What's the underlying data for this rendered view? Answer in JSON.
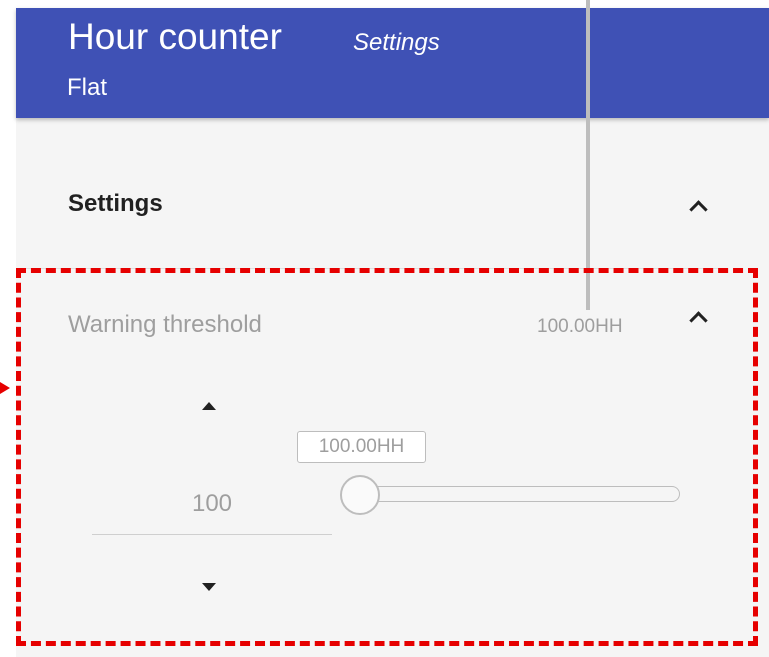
{
  "header": {
    "title": "Hour counter",
    "subtitle": "Settings",
    "device": "Flat",
    "color": "#3f51b5"
  },
  "settings_section": {
    "label": "Settings",
    "icon": "chevron-up-icon"
  },
  "warning_threshold": {
    "label": "Warning threshold",
    "value": "100.00HH",
    "icon": "chevron-up-icon",
    "stepper": {
      "value": "100",
      "up_icon": "arrow-up-icon",
      "down_icon": "arrow-down-icon"
    },
    "slider": {
      "tooltip": "100.00HH",
      "position_fraction": 0.0
    }
  },
  "annotation": {
    "highlight_color": "#e60000",
    "pointer_color": "#bdbdbd"
  }
}
